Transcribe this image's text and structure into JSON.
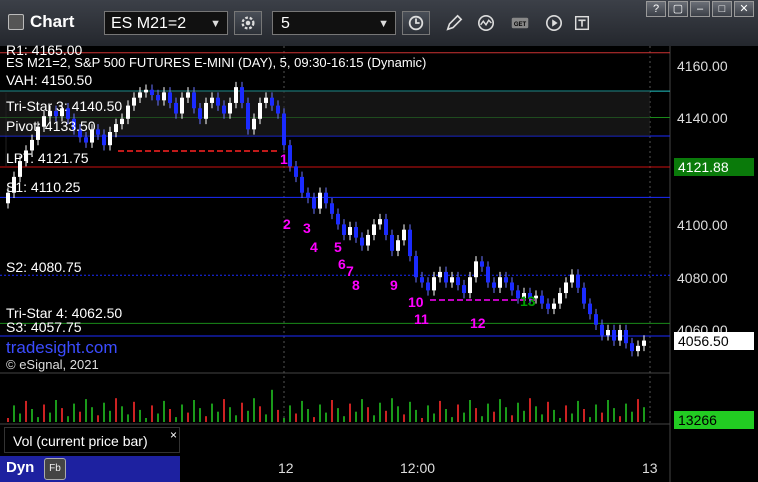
{
  "toolbar": {
    "title": "Chart",
    "symbol": "ES M21=2",
    "interval": "5"
  },
  "chart": {
    "header": "ES M21=2, S&P 500 FUTURES E-MINI (DAY), 5, 09:30-16:15 (Dynamic)",
    "brand": "tradesight.com",
    "copyright": "© eSignal, 2021",
    "levels": [
      {
        "text": "R1: 4165.00",
        "price": 4165.0
      },
      {
        "text": "VAH: 4150.50",
        "price": 4150.5
      },
      {
        "text": "Tri-Star 3: 4140.50",
        "price": 4140.5
      },
      {
        "text": "Pivot: 4133.50",
        "price": 4133.5
      },
      {
        "text": "LPT: 4121.75",
        "price": 4121.75
      },
      {
        "text": "S1: 4110.25",
        "price": 4110.25
      },
      {
        "text": "S2: 4080.75",
        "price": 4080.75
      },
      {
        "text": "Tri-Star 4: 4062.50",
        "price": 4062.5
      },
      {
        "text": "S3: 4057.75",
        "price": 4057.75
      }
    ],
    "y_axis_ticks": [
      "4160.00",
      "4140.00",
      "4100.00",
      "4080.00",
      "4060.00"
    ],
    "last_price": "4056.50",
    "lpt_tag": "4121.88",
    "vol_value": "13266",
    "x_axis": [
      "12",
      "12:00",
      "13"
    ],
    "vol_panel_label": "Vol (current price bar)",
    "vol_close": "×",
    "dyn_label": "Dyn",
    "countdown": [
      "1",
      "2",
      "3",
      "4",
      "5",
      "6",
      "7",
      "8",
      "9",
      "10",
      "11",
      "12",
      "13"
    ]
  },
  "colors": {
    "background": "#000000",
    "bull": "#ffffff",
    "bear": "#1b2bff",
    "count_magenta": "#ff00ff",
    "count_green": "#00a000",
    "lpt_tag": "#0a7a0a",
    "vol_tag": "#22cc22"
  }
}
